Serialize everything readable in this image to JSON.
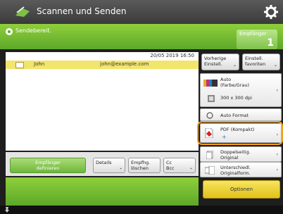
{
  "title": "Scannen und Senden",
  "status_text": "Sendebereit.",
  "recipient_count": {
    "label": "Empfänger",
    "value": "1"
  },
  "timestamp": "20/05 2019 16:50",
  "recipients": [
    {
      "name": "John",
      "email": "john@example.com"
    }
  ],
  "buttons": {
    "specify_recipient": [
      "Empfänger",
      "definieren"
    ],
    "details": "Details",
    "empfhg_loeschen": [
      "Empfhg.",
      "löschen"
    ],
    "cc_bcc": [
      "Cc",
      "Bcc"
    ],
    "previous_settings": [
      "Vorherige",
      "Einstell."
    ],
    "favorites": [
      "Einstell.",
      "favoriten"
    ],
    "color_mode": [
      "Auto",
      "(Farbe/Grau)"
    ],
    "resolution": "300 x 300 dpi",
    "size": "Auto Format",
    "file_format": "PDF (Kompakt)",
    "duplex": [
      "Doppelseitig.",
      "Original"
    ],
    "mixed_size": [
      "Unterschiedl.",
      "Originalform."
    ],
    "options": "Optionen"
  },
  "colors": {
    "accent_green": "#6fb63a",
    "highlight_orange": "#f4a11a",
    "selected_row": "#f2e56b",
    "options_yellow": "#e8c827"
  },
  "icons": [
    "scanner-icon",
    "gear-icon",
    "status-dot-icon",
    "contact-card-icon",
    "color-mode-icon",
    "resolution-icon",
    "auto-size-icon",
    "pdf-icon",
    "duplex-icon",
    "mixed-size-icon",
    "pin-icon"
  ]
}
